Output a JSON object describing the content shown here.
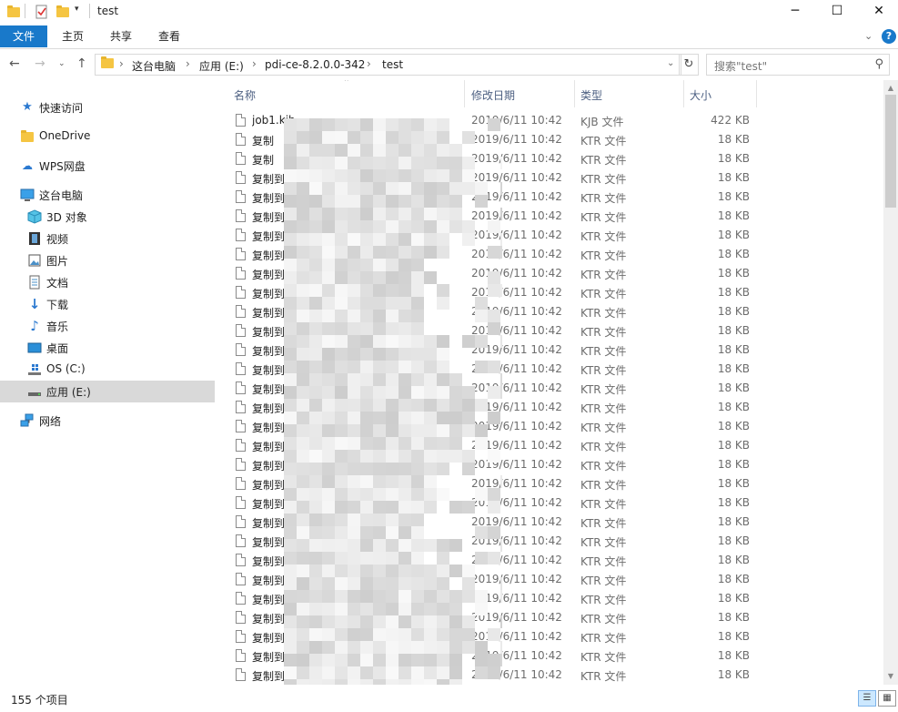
{
  "window": {
    "title": "test",
    "minimize": "─",
    "maximize": "☐",
    "close": "✕"
  },
  "ribbon": {
    "file": "文件",
    "home": "主页",
    "share": "共享",
    "view": "查看"
  },
  "address": {
    "crumbs": [
      "这台电脑",
      "应用 (E:)",
      "pdi-ce-8.2.0.0-342",
      "test"
    ],
    "search_placeholder": "搜索\"test\""
  },
  "nav": {
    "quick_access": "快速访问",
    "onedrive": "OneDrive",
    "wps": "WPS网盘",
    "this_pc": "这台电脑",
    "objects3d": "3D 对象",
    "videos": "视频",
    "pictures": "图片",
    "documents": "文档",
    "downloads": "下载",
    "music": "音乐",
    "desktop": "桌面",
    "os_c": "OS (C:)",
    "app_e": "应用 (E:)",
    "network": "网络"
  },
  "columns": {
    "name": "名称",
    "modified": "修改日期",
    "type": "类型",
    "size": "大小"
  },
  "files": [
    {
      "name": "job1.kjb",
      "date": "2019/6/11 10:42",
      "type": "KJB 文件",
      "size": "422 KB"
    },
    {
      "name": "复制",
      "date": "2019/6/11 10:42",
      "type": "KTR 文件",
      "size": "18 KB"
    },
    {
      "name": "复制",
      "date": "2019/6/11 10:42",
      "type": "KTR 文件",
      "size": "18 KB"
    },
    {
      "name": "复制到",
      "date": "2019/6/11 10:42",
      "type": "KTR 文件",
      "size": "18 KB"
    },
    {
      "name": "复制到_",
      "date": "2019/6/11 10:42",
      "type": "KTR 文件",
      "size": "18 KB"
    },
    {
      "name": "复制到_s",
      "date": "2019/6/11 10:42",
      "type": "KTR 文件",
      "size": "18 KB"
    },
    {
      "name": "复制到_s",
      "date": "2019/6/11 10:42",
      "type": "KTR 文件",
      "size": "18 KB"
    },
    {
      "name": "复制到_s",
      "date": "2019/6/11 10:42",
      "type": "KTR 文件",
      "size": "18 KB"
    },
    {
      "name": "复制到_s",
      "date": "2019/6/11 10:42",
      "type": "KTR 文件",
      "size": "18 KB"
    },
    {
      "name": "复制到_s",
      "date": "2019/6/11 10:42",
      "type": "KTR 文件",
      "size": "18 KB"
    },
    {
      "name": "复制到_s",
      "date": "2019/6/11 10:42",
      "type": "KTR 文件",
      "size": "18 KB"
    },
    {
      "name": "复制到_s",
      "date": "2019/6/11 10:42",
      "type": "KTR 文件",
      "size": "18 KB"
    },
    {
      "name": "复制到_",
      "date": "2019/6/11 10:42",
      "type": "KTR 文件",
      "size": "18 KB"
    },
    {
      "name": "复制到",
      "date": "2019/6/11 10:42",
      "type": "KTR 文件",
      "size": "18 KB"
    },
    {
      "name": "复制到",
      "date": "2019/6/11 10:42",
      "type": "KTR 文件",
      "size": "18 KB"
    },
    {
      "name": "复制到",
      "date": "2019/6/11 10:42",
      "type": "KTR 文件",
      "size": "18 KB"
    },
    {
      "name": "复制到",
      "date": "2019/6/11 10:42",
      "type": "KTR 文件",
      "size": "18 KB"
    },
    {
      "name": "复制到",
      "date": "2019/6/11 10:42",
      "type": "KTR 文件",
      "size": "18 KB"
    },
    {
      "name": "复制到",
      "date": "2019/6/11 10:42",
      "type": "KTR 文件",
      "size": "18 KB"
    },
    {
      "name": "复制到",
      "date": "2019/6/11 10:42",
      "type": "KTR 文件",
      "size": "18 KB"
    },
    {
      "name": "复制到",
      "date": "2019/6/11 10:42",
      "type": "KTR 文件",
      "size": "18 KB"
    },
    {
      "name": "复制到",
      "date": "2019/6/11 10:42",
      "type": "KTR 文件",
      "size": "18 KB"
    },
    {
      "name": "复制到",
      "date": "2019/6/11 10:42",
      "type": "KTR 文件",
      "size": "18 KB"
    },
    {
      "name": "复制到",
      "date": "2019/6/11 10:42",
      "type": "KTR 文件",
      "size": "18 KB"
    },
    {
      "name": "复制到",
      "date": "2019/6/11 10:42",
      "type": "KTR 文件",
      "size": "18 KB"
    },
    {
      "name": "复制到",
      "date": "2019/6/11 10:42",
      "type": "KTR 文件",
      "size": "18 KB"
    },
    {
      "name": "复制到",
      "date": "2019/6/11 10:42",
      "type": "KTR 文件",
      "size": "18 KB"
    },
    {
      "name": "复制到",
      "date": "2019/6/11 10:42",
      "type": "KTR 文件",
      "size": "18 KB"
    },
    {
      "name": "复制到",
      "date": "2019/6/11 10:42",
      "type": "KTR 文件",
      "size": "18 KB"
    },
    {
      "name": "复制到",
      "date": "2019/6/11 10:42",
      "type": "KTR 文件",
      "size": "18 KB"
    },
    {
      "name": "复制到",
      "date": "2019/6/11 10:42",
      "type": "KTR 文件",
      "size": "18 KB"
    }
  ],
  "status": {
    "count": "155 个项目"
  },
  "colors": {
    "file_tab": "#1979ca",
    "selected_nav": "#d9d9d9",
    "header_text": "#4d6082"
  }
}
